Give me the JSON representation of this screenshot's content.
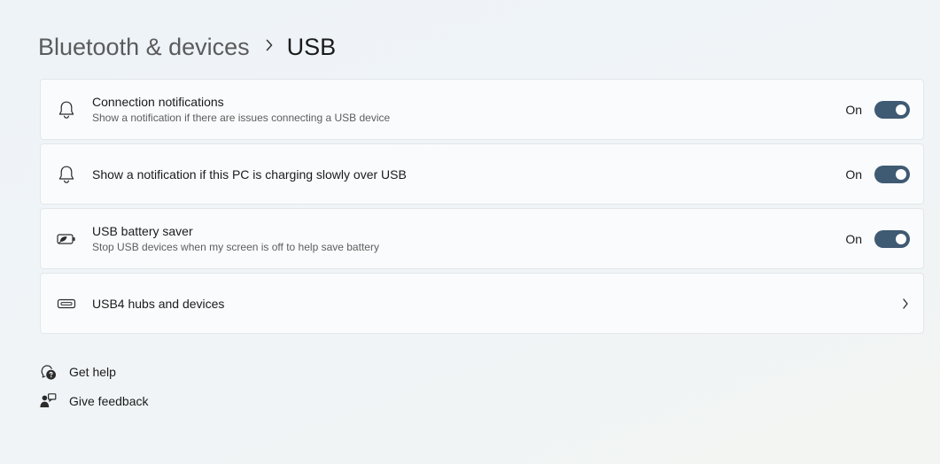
{
  "breadcrumb": {
    "parent": "Bluetooth & devices",
    "separator_icon": "chevron-right-icon",
    "current": "USB"
  },
  "settings": [
    {
      "id": "connection-notifications",
      "icon": "bell-icon",
      "title": "Connection notifications",
      "description": "Show a notification if there are issues connecting a USB device",
      "toggle_label": "On",
      "toggle_on": true
    },
    {
      "id": "slow-charging-notification",
      "icon": "bell-icon",
      "title": "Show a notification if this PC is charging slowly over USB",
      "toggle_label": "On",
      "toggle_on": true
    },
    {
      "id": "usb-battery-saver",
      "icon": "battery-saver-icon",
      "title": "USB battery saver",
      "description": "Stop USB devices when my screen is off to help save battery",
      "toggle_label": "On",
      "toggle_on": true
    },
    {
      "id": "usb4-hubs",
      "icon": "usb-port-icon",
      "title": "USB4 hubs and devices",
      "action_icon": "chevron-right-icon"
    }
  ],
  "links": [
    {
      "icon": "help-icon",
      "label": "Get help"
    },
    {
      "icon": "feedback-icon",
      "label": "Give feedback"
    }
  ],
  "colors": {
    "toggle_on": "#3f5a73",
    "card_background": "#f9fbfc",
    "card_border": "#e3e7ea",
    "text_primary": "#1b1b1b",
    "text_secondary": "#5e5e5e"
  }
}
